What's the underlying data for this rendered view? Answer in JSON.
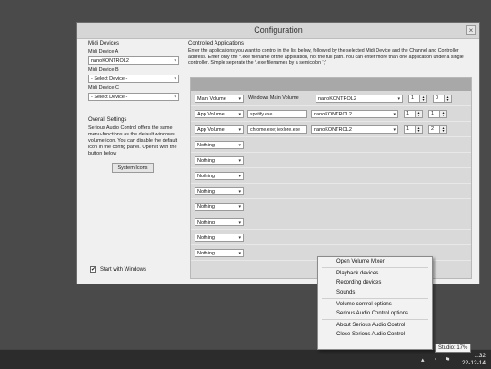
{
  "window": {
    "title": "Configuration",
    "close_symbol": "×"
  },
  "midi": {
    "group_label": "Midi Devices",
    "devices": [
      {
        "label": "Midi Device A",
        "value": "nanoKONTROL2"
      },
      {
        "label": "Midi Device B",
        "value": "- Select Device -"
      },
      {
        "label": "Midi Device C",
        "value": "- Select Device -"
      }
    ]
  },
  "overall": {
    "group_label": "Overall Settings",
    "description": "Serious Audio Control offers the same menu-functions as the default windows volume icon. You can disable the default icon in the config panel. Open it with the button below",
    "system_icons_button": "System Icons",
    "start_with_windows_label": "Start with Windows",
    "start_with_windows_checked": true
  },
  "apps": {
    "group_label": "Controlled Applications",
    "intro": "Enter the applications you want to control in the list below, followed by the selected Midi Device and the Channel and Controller address. Enter only the *.exe filename of the application, not the full path. You can enter more than one application under a single controller. Simple seperate the *.exe filenames by a semicolon ';'",
    "rows": [
      {
        "action": "Main Volume",
        "static_text": "Windows Main Volume",
        "device": "nanoKONTROL2",
        "channel": "1",
        "controller": "0"
      },
      {
        "action": "App Volume",
        "exe": "spotify.exe",
        "device": "nanoKONTROL2",
        "channel": "1",
        "controller": "1"
      },
      {
        "action": "App Volume",
        "exe": "chrome.exe; iexlore.exe",
        "device": "nanoKONTROL2",
        "channel": "1",
        "controller": "2"
      },
      {
        "action": "Nothing"
      },
      {
        "action": "Nothing"
      },
      {
        "action": "Nothing"
      },
      {
        "action": "Nothing"
      },
      {
        "action": "Nothing"
      },
      {
        "action": "Nothing"
      },
      {
        "action": "Nothing"
      },
      {
        "action": "Nothing"
      }
    ]
  },
  "context_menu": {
    "groups": [
      [
        "Open Volume Mixer"
      ],
      [
        "Playback devices",
        "Recording devices",
        "Sounds"
      ],
      [
        "Volume control options",
        "Serious Audio Control options"
      ],
      [
        "About Serious Audio Control",
        "Close Serious Audio Control"
      ]
    ]
  },
  "taskbar": {
    "tooltip": "Studio: 17%",
    "time": "...32",
    "date": "22-12-14"
  }
}
